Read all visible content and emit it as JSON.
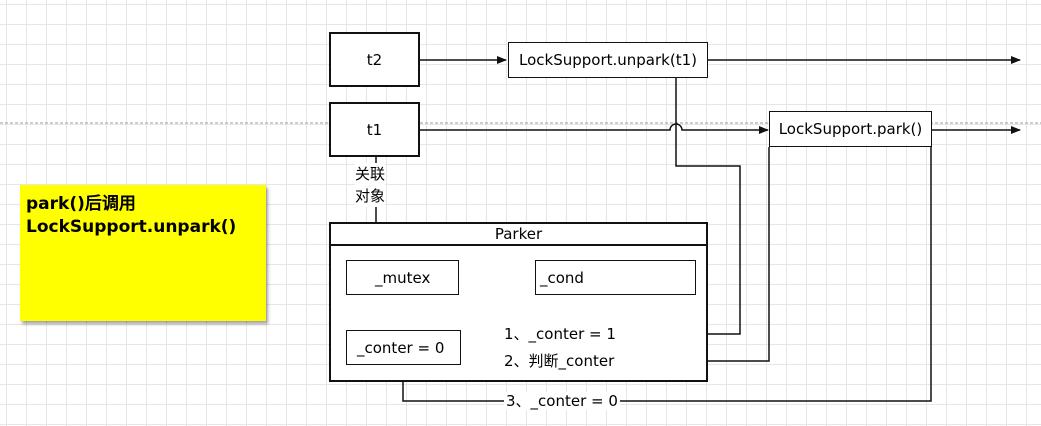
{
  "nodes": {
    "t2": "t2",
    "t1": "t1",
    "unpark": "LockSupport.unpark(t1)",
    "park": "LockSupport.park()",
    "parker_title": "Parker",
    "mutex": "_mutex",
    "cond": "_cond",
    "counter": "_conter = 0"
  },
  "association": {
    "line1": "关联",
    "line2": "对象"
  },
  "edge_labels": {
    "step1": "1、_conter = 1",
    "step2": "2、判断_conter",
    "step3": "3、_conter = 0"
  },
  "note": {
    "line1": "park()后调用",
    "line2": "LockSupport.unpark()",
    "color": "#ffff00"
  }
}
